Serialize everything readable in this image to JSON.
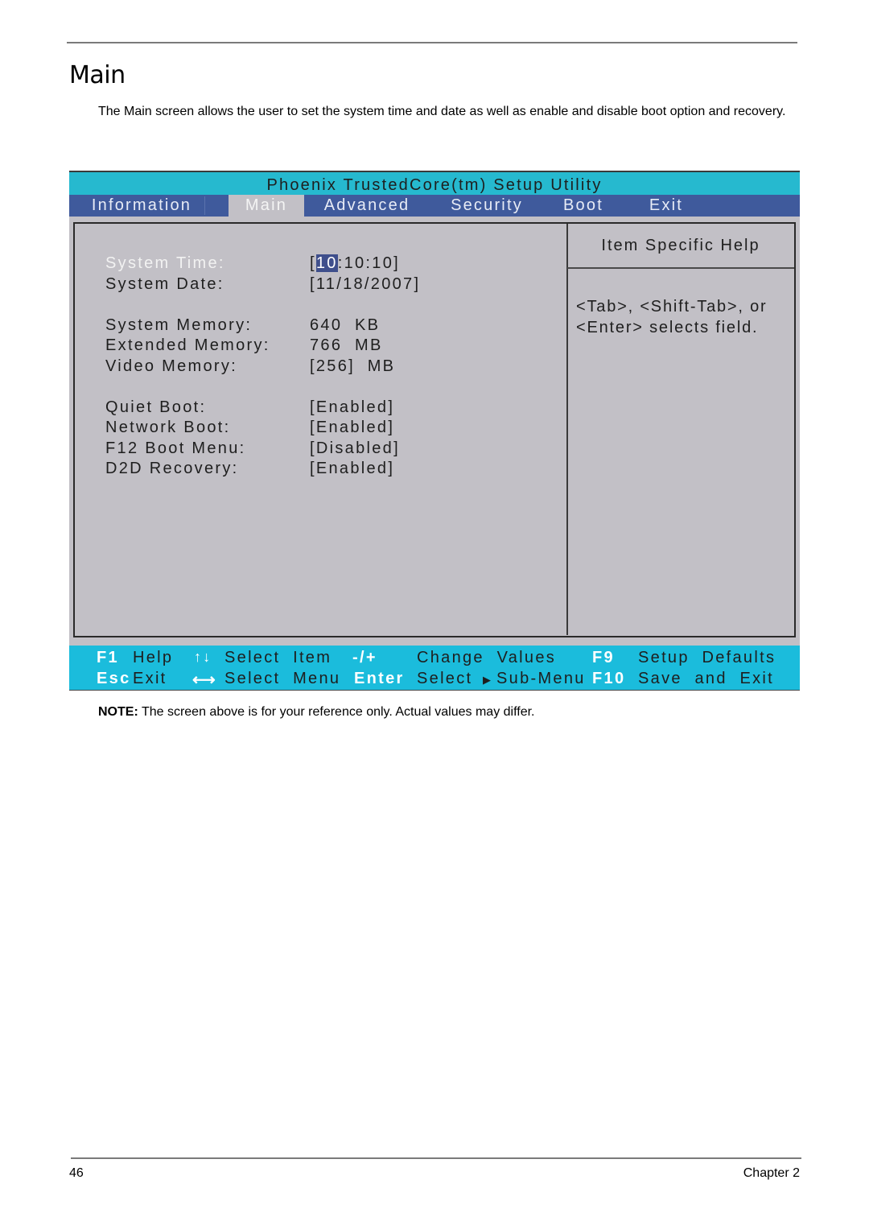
{
  "document": {
    "section_title": "Main",
    "intro": "The Main screen allows the user to set the system time and date as well as enable and disable boot option and recovery.",
    "note_label": "NOTE:",
    "note_text": " The screen above is for your reference only. Actual values may differ.",
    "page_number": "46",
    "chapter": "Chapter 2"
  },
  "bios": {
    "title": "Phoenix TrustedCore(tm) Setup Utility",
    "menu": [
      {
        "label": "Information",
        "active": false
      },
      {
        "label": "Main",
        "active": true
      },
      {
        "label": "Advanced",
        "active": false
      },
      {
        "label": "Security",
        "active": false
      },
      {
        "label": "Boot",
        "active": false
      },
      {
        "label": "Exit",
        "active": false
      }
    ],
    "fields": {
      "system_time": {
        "label": "System Time:",
        "value_prefix": "[",
        "value_highlight": "10",
        "value_rest": ":10:10]",
        "selected": true
      },
      "system_date": {
        "label": "System Date:",
        "value": "[11/18/2007]"
      },
      "system_memory": {
        "label": "System Memory:",
        "value": "640  KB"
      },
      "extended_memory": {
        "label": "Extended Memory:",
        "value": "766  MB"
      },
      "video_memory": {
        "label": "Video Memory:",
        "value": "[256]  MB"
      },
      "quiet_boot": {
        "label": "Quiet Boot:",
        "value": "[Enabled]"
      },
      "network_boot": {
        "label": "Network Boot:",
        "value": "[Enabled]"
      },
      "f12_boot_menu": {
        "label": "F12 Boot Menu:",
        "value": "[Disabled]"
      },
      "d2d_recovery": {
        "label": "D2D Recovery:",
        "value": "[Enabled]"
      }
    },
    "help": {
      "title": "Item Specific Help",
      "text": "<Tab>, <Shift-Tab>, or\n<Enter> selects field."
    },
    "footer": {
      "f1_key": "F1",
      "f1_label": "Help",
      "updown_icon": "↑↓",
      "select_item": "Select  Item",
      "minus_plus_key": "-/+",
      "change_values": "Change  Values",
      "f9_key": "F9",
      "setup_defaults": "Setup  Defaults",
      "esc_key": "Esc",
      "esc_label": "Exit",
      "leftright_icon": "⟷",
      "select_menu": "Select  Menu",
      "enter_key": "Enter",
      "select_submenu": "Select",
      "submenu_arrow": "▶",
      "submenu_label": "Sub-Menu",
      "f10_key": "F10",
      "save_exit": "Save  and  Exit"
    }
  }
}
